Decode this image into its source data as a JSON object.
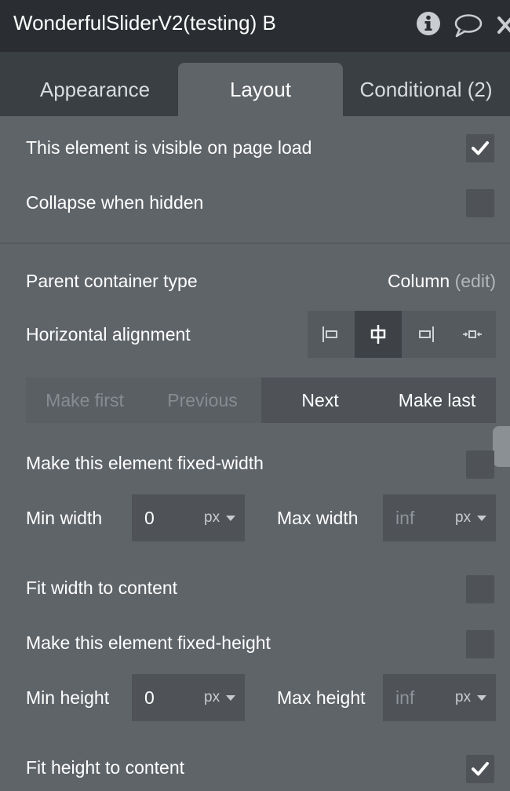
{
  "window": {
    "title": "WonderfulSliderV2(testing) B"
  },
  "tabs": [
    {
      "label": "Appearance",
      "active": false
    },
    {
      "label": "Layout",
      "active": true
    },
    {
      "label": "Conditional (2)",
      "active": false
    }
  ],
  "visibility": {
    "visible_on_load_label": "This element is visible on page load",
    "visible_on_load_checked": true,
    "collapse_when_hidden_label": "Collapse when hidden",
    "collapse_when_hidden_checked": false
  },
  "layout": {
    "parent_container_label": "Parent container type",
    "parent_container_value": "Column",
    "parent_container_edit": "(edit)",
    "horizontal_alignment_label": "Horizontal alignment",
    "horizontal_alignment_options": [
      "left",
      "center",
      "right",
      "stretch"
    ],
    "horizontal_alignment_selected": "center",
    "order_buttons": {
      "make_first": "Make first",
      "previous": "Previous",
      "next": "Next",
      "make_last": "Make last"
    }
  },
  "width": {
    "fixed_width_label": "Make this element fixed-width",
    "fixed_width_checked": false,
    "min_width_label": "Min width",
    "min_width_value": "0",
    "min_width_unit": "px",
    "max_width_label": "Max width",
    "max_width_placeholder": "inf",
    "max_width_unit": "px",
    "fit_width_label": "Fit width to content",
    "fit_width_checked": false
  },
  "height": {
    "fixed_height_label": "Make this element fixed-height",
    "fixed_height_checked": false,
    "min_height_label": "Min height",
    "min_height_value": "0",
    "min_height_unit": "px",
    "max_height_label": "Max height",
    "max_height_placeholder": "inf",
    "max_height_unit": "px",
    "fit_height_label": "Fit height to content",
    "fit_height_checked": true
  },
  "icons": {
    "info": "info-icon",
    "comment": "comment-icon",
    "close": "close-icon"
  }
}
